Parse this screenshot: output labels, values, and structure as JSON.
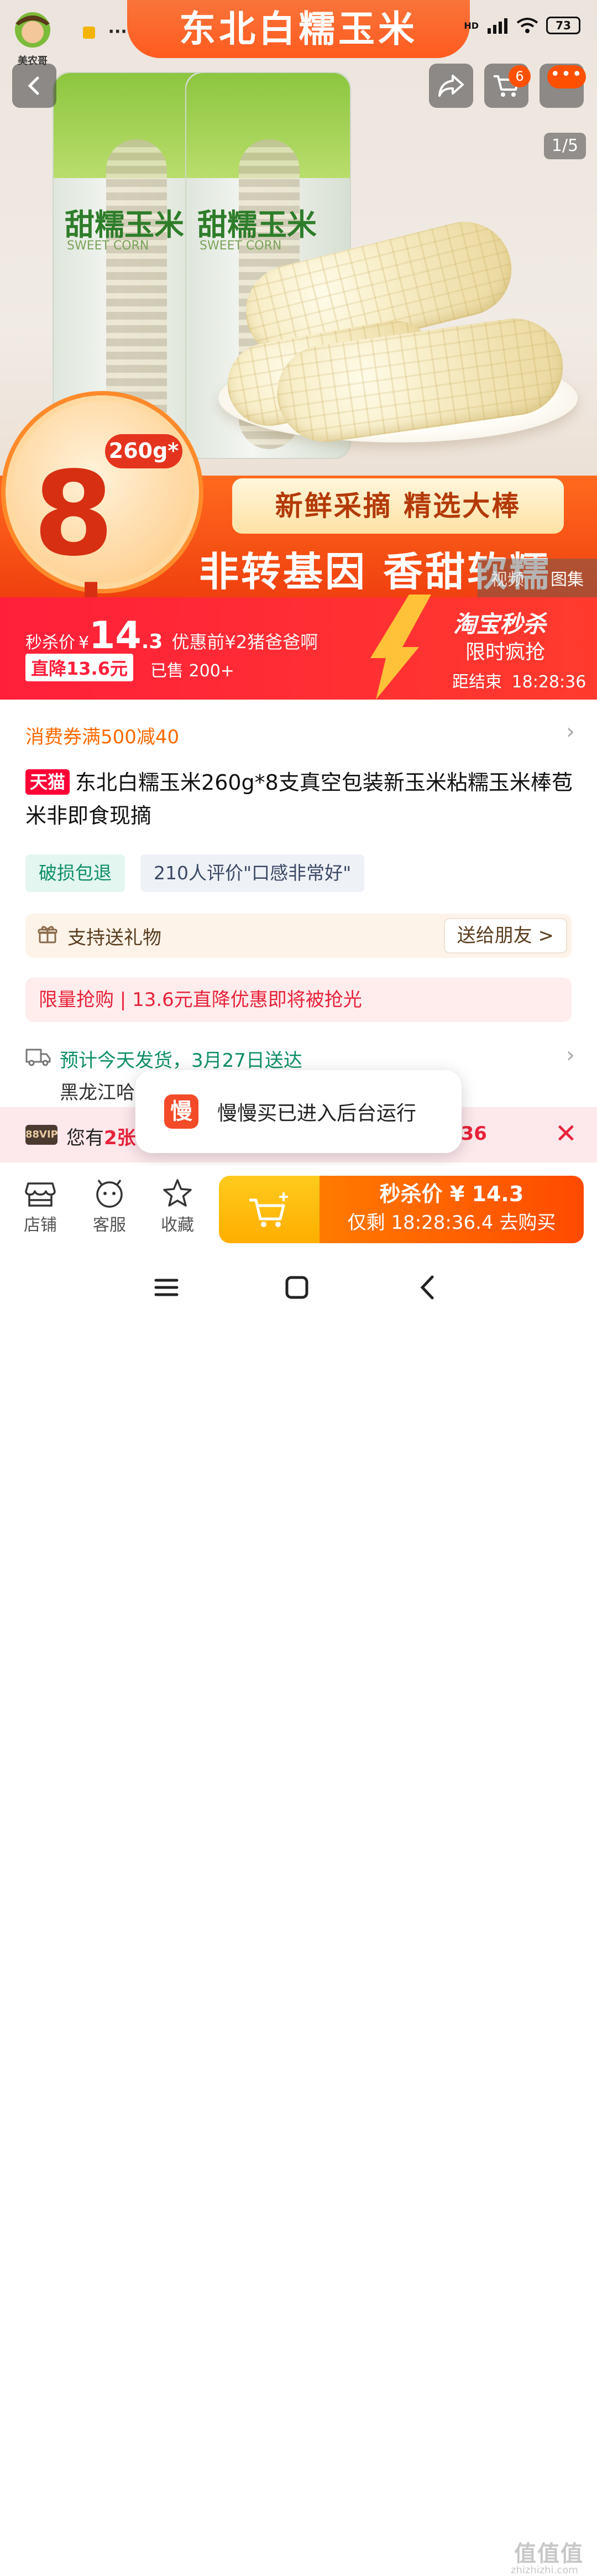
{
  "status_bar": {
    "dots": "···",
    "network": "HD",
    "battery": "73"
  },
  "hero": {
    "banner_title": "东北白糯玉米",
    "logo_text": "美农哥",
    "cart_badge": "6",
    "pager": "1/5",
    "bag_name": "甜糯玉米",
    "bag_sub": "SWEET CORN",
    "spec": "260g*",
    "count": "8支",
    "slogan1": "新鲜采摘 精选大棒",
    "slogan2": "非转基因 香甜软糯",
    "media_tabs": [
      "视频",
      "图集"
    ]
  },
  "flash": {
    "price_label": "秒杀价",
    "currency": "¥",
    "price_int": "14",
    "price_dec": ".3",
    "original_label": "优惠前¥2猪爸爸啊",
    "drop_tag": "直降13.6元",
    "sold": "已售 200+",
    "seckill_title": "淘宝秒杀",
    "seckill_sub": "限时疯抢",
    "countdown_label": "距结束",
    "countdown": "18:28:36"
  },
  "product": {
    "coupon": "消费券满500减40",
    "store_badge": "天猫",
    "title": "东北白糯玉米260g*8支真空包装新玉米粘糯玉米棒苞米非即食现摘",
    "tags": [
      "破损包退",
      "210人评价\"口感非常好\""
    ],
    "gift_label": "支持送礼物",
    "gift_button": "送给朋友 >",
    "limit_text": "限量抢购 | 13.6元直降优惠即将被抢光",
    "shipping": "预计今天发货，3月27日送达",
    "address": "黑龙江哈"
  },
  "vip_bar": {
    "vip": "88VIP",
    "text_pre": "您有",
    "count": "2张",
    "right_text": ":36",
    "close": "✕"
  },
  "toast": {
    "icon_char": "慢",
    "message": "慢慢买已进入后台运行"
  },
  "bottom_bar": {
    "items": [
      {
        "label": "店铺",
        "icon": "store-icon"
      },
      {
        "label": "客服",
        "icon": "service-icon"
      },
      {
        "label": "收藏",
        "icon": "star-icon"
      }
    ],
    "buy_line1": "秒杀价 ¥ 14.3",
    "buy_line2": "仅剩 18:28:36.4 去购买"
  },
  "watermark": {
    "main": "值值值",
    "sub": "zhizhizhi.com"
  }
}
